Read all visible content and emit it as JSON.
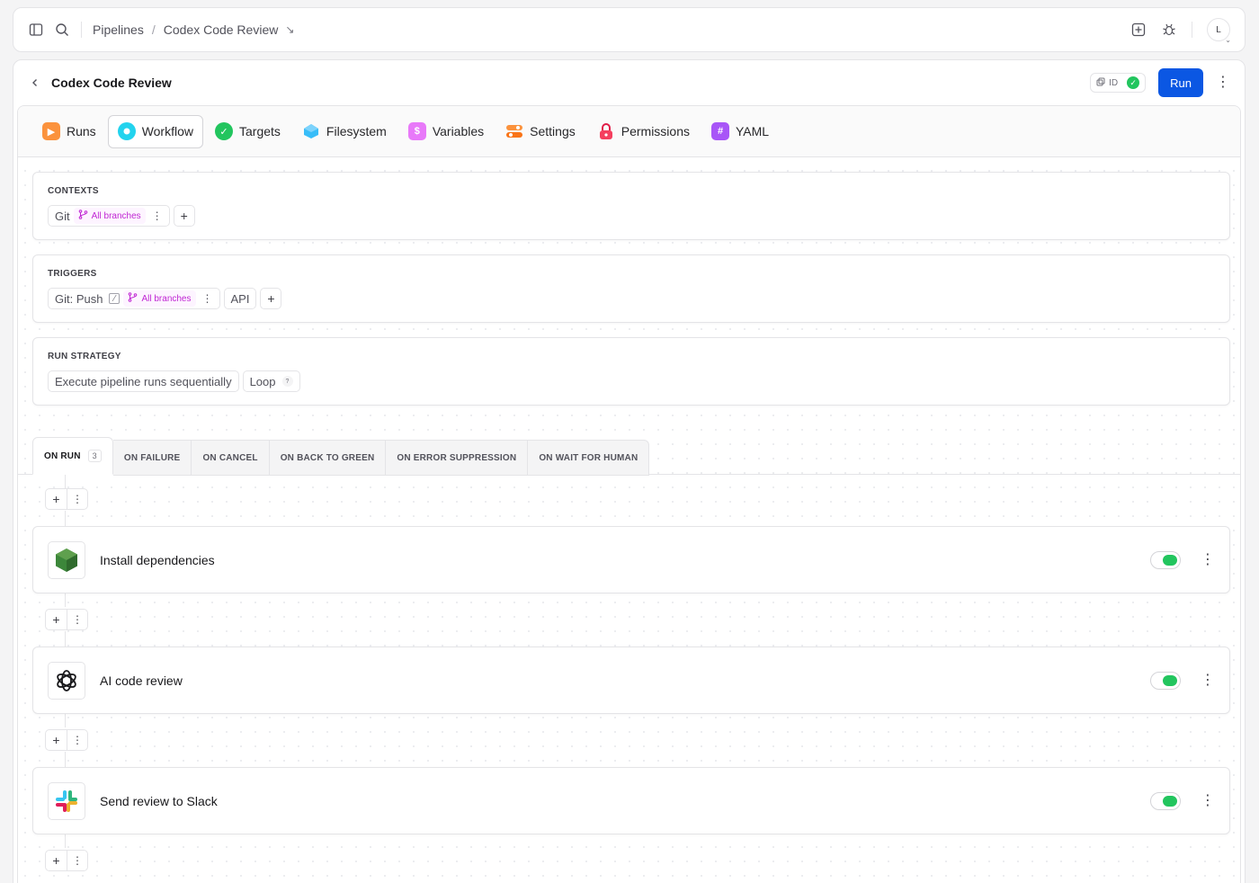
{
  "breadcrumb": {
    "root": "Pipelines",
    "current": "Codex Code Review"
  },
  "avatar": {
    "initial": "L"
  },
  "header": {
    "title": "Codex Code Review",
    "id_label": "ID",
    "run_label": "Run"
  },
  "tabs": [
    {
      "label": "Runs",
      "icon": "play-icon",
      "color": "#f97316"
    },
    {
      "label": "Workflow",
      "icon": "workflow-icon",
      "color": "#06b6d4"
    },
    {
      "label": "Targets",
      "icon": "target-icon",
      "color": "#22c55e"
    },
    {
      "label": "Filesystem",
      "icon": "filesystem-icon",
      "color": "#0ea5e9"
    },
    {
      "label": "Variables",
      "icon": "dollar-icon",
      "color": "#d946ef"
    },
    {
      "label": "Settings",
      "icon": "settings-icon",
      "color": "#f97316"
    },
    {
      "label": "Permissions",
      "icon": "lock-icon",
      "color": "#e11d48"
    },
    {
      "label": "YAML",
      "icon": "hash-icon",
      "color": "#9333ea"
    }
  ],
  "contexts": {
    "label": "CONTEXTS",
    "chip": "Git",
    "branch": "All branches"
  },
  "triggers": {
    "label": "TRIGGERS",
    "chip": "Git: Push",
    "branch": "All branches",
    "api": "API"
  },
  "strategy": {
    "label": "RUN STRATEGY",
    "mode": "Execute pipeline runs sequentially",
    "loop": "Loop",
    "help": "?"
  },
  "action_tabs": [
    {
      "label": "ON RUN",
      "count": "3"
    },
    {
      "label": "ON FAILURE"
    },
    {
      "label": "ON CANCEL"
    },
    {
      "label": "ON BACK TO GREEN"
    },
    {
      "label": "ON ERROR SUPPRESSION"
    },
    {
      "label": "ON WAIT FOR HUMAN"
    }
  ],
  "actions": [
    {
      "name": "Install dependencies",
      "icon": "nodejs-icon",
      "enabled": true
    },
    {
      "name": "AI code review",
      "icon": "openai-icon",
      "enabled": true
    },
    {
      "name": "Send review to Slack",
      "icon": "slack-icon",
      "enabled": true
    }
  ],
  "colors": {
    "accent": "#0b57e3",
    "success": "#22c55e",
    "branch": "#c026d3"
  }
}
